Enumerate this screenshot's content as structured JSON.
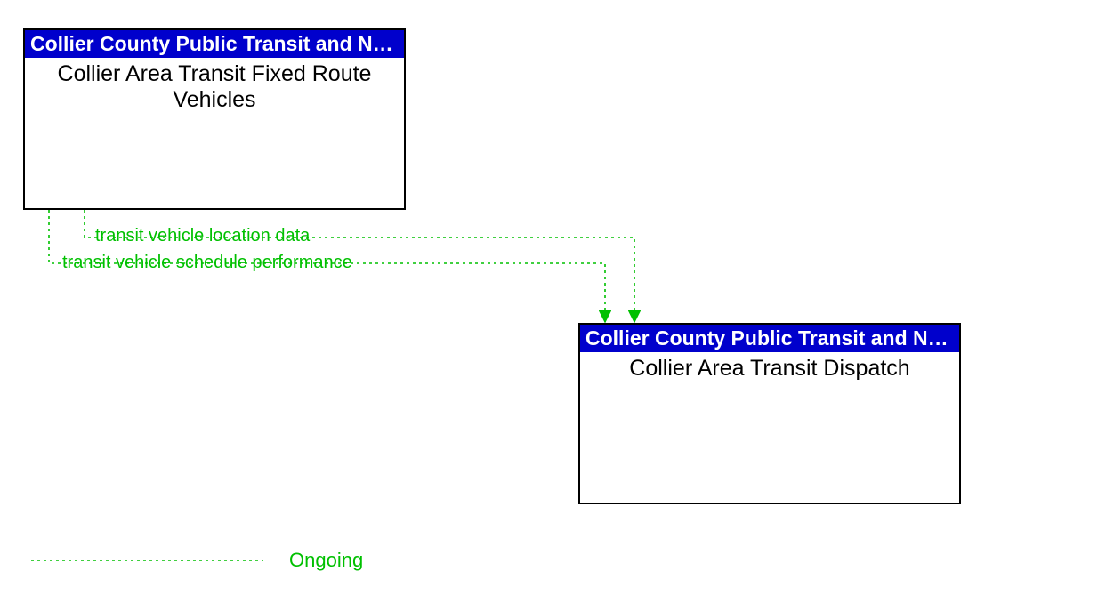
{
  "entities": {
    "top": {
      "header": "Collier County Public Transit and Nei...",
      "body": "Collier Area Transit Fixed Route Vehicles"
    },
    "bottom": {
      "header": "Collier County Public Transit and Nei...",
      "body": "Collier Area Transit Dispatch"
    }
  },
  "flows": {
    "f1": "transit vehicle location data",
    "f2": "transit vehicle schedule performance"
  },
  "legend": {
    "ongoing": "Ongoing"
  },
  "colors": {
    "header_bg": "#0000cc",
    "flow": "#00c000"
  },
  "chart_data": {
    "type": "diagram",
    "nodes": [
      {
        "id": "n1",
        "owner": "Collier County Public Transit and Nei...",
        "label": "Collier Area Transit Fixed Route Vehicles"
      },
      {
        "id": "n2",
        "owner": "Collier County Public Transit and Nei...",
        "label": "Collier Area Transit Dispatch"
      }
    ],
    "edges": [
      {
        "from": "n1",
        "to": "n2",
        "label": "transit vehicle location data",
        "status": "Ongoing"
      },
      {
        "from": "n1",
        "to": "n2",
        "label": "transit vehicle schedule performance",
        "status": "Ongoing"
      }
    ],
    "legend": [
      {
        "style": "dotted-green",
        "label": "Ongoing"
      }
    ]
  }
}
